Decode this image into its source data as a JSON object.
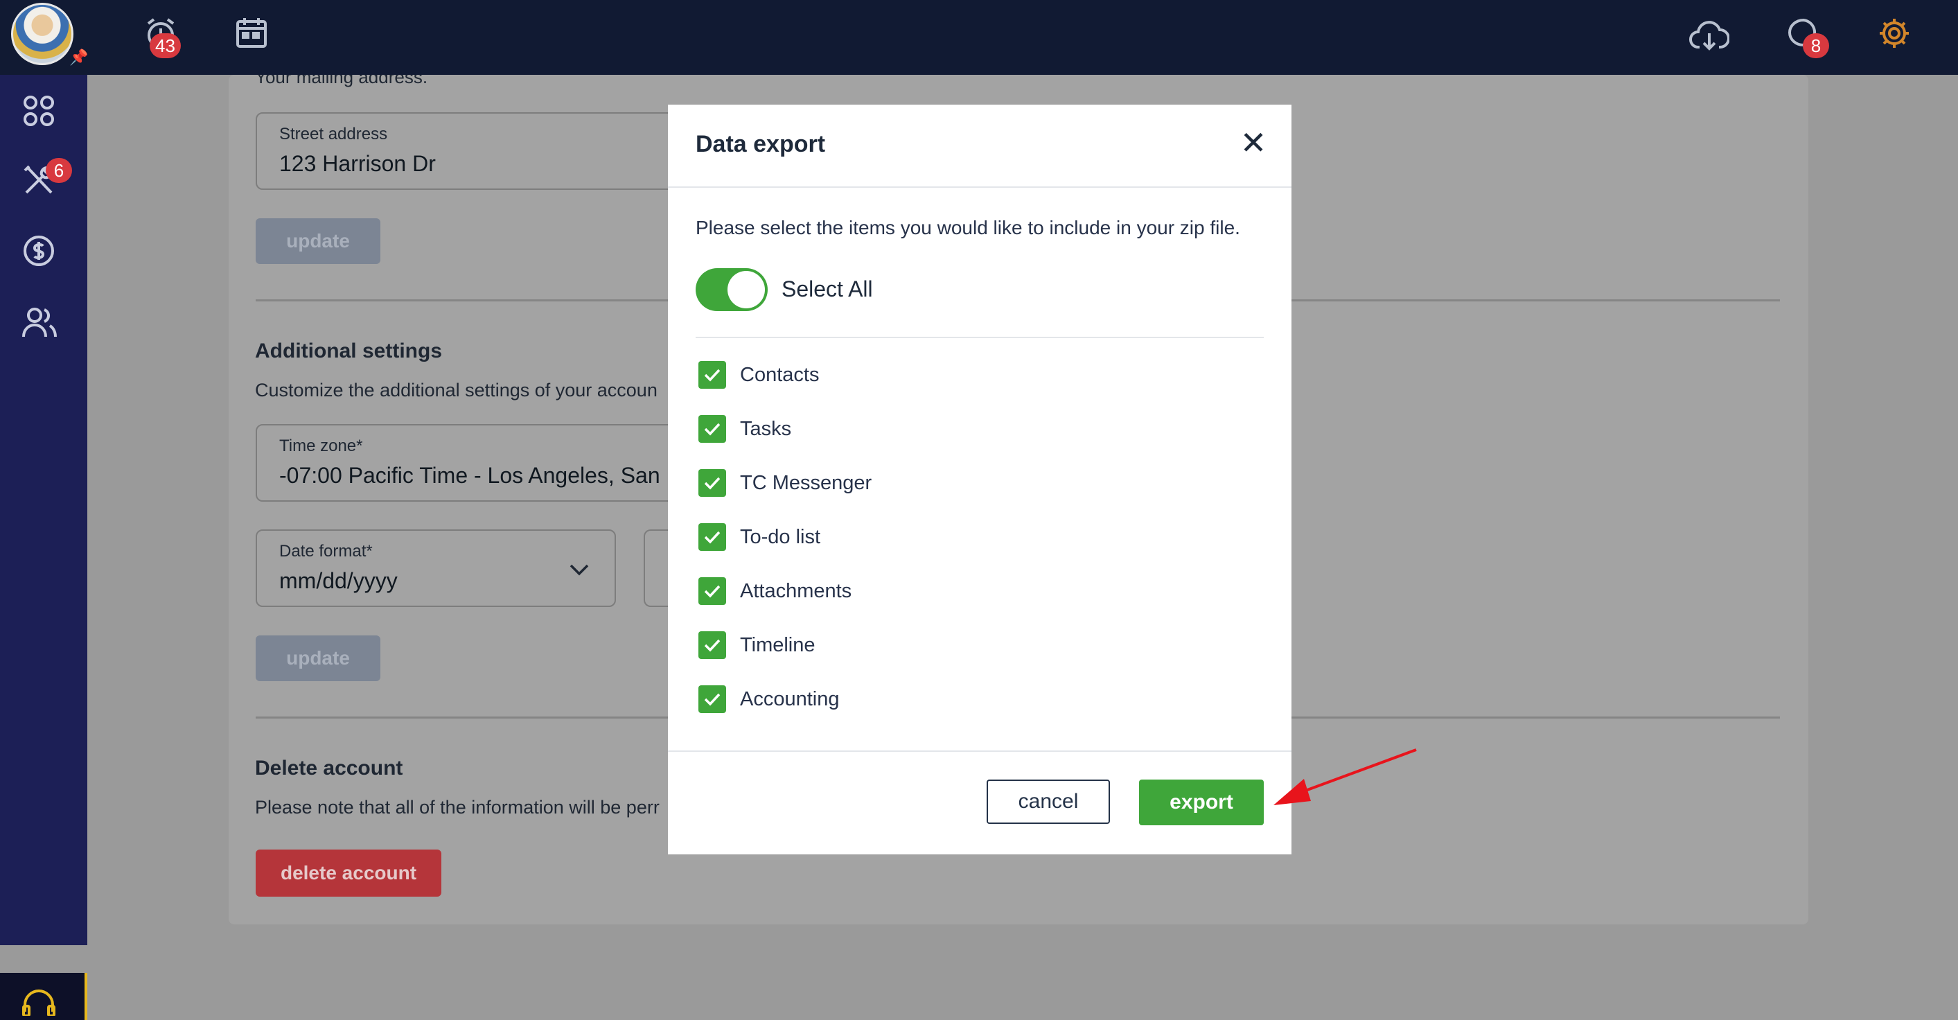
{
  "topbar": {
    "reminders_badge": "43",
    "messages_badge": "8"
  },
  "sidebar": {
    "tools_badge": "6"
  },
  "background": {
    "mailing_text": "Your mailing address.",
    "street": {
      "label": "Street address",
      "value": "123 Harrison Dr"
    },
    "update_label": "update",
    "additional_title": "Additional settings",
    "additional_desc": "Customize the additional settings of your accoun",
    "timezone": {
      "label": "Time zone*",
      "value": "-07:00 Pacific Time - Los Angeles, San D"
    },
    "dateformat": {
      "label": "Date format*",
      "value": "mm/dd/yyyy"
    },
    "delete_title": "Delete account",
    "delete_desc": "Please note that all of the information will be perr",
    "delete_button": "delete account"
  },
  "modal": {
    "title": "Data export",
    "close_symbol": "✕",
    "description": "Please select the items you would like to include in your zip file.",
    "select_all_label": "Select All",
    "select_all_on": true,
    "items": [
      {
        "label": "Contacts",
        "checked": true
      },
      {
        "label": "Tasks",
        "checked": true
      },
      {
        "label": "TC Messenger",
        "checked": true
      },
      {
        "label": "To-do list",
        "checked": true
      },
      {
        "label": "Attachments",
        "checked": true
      },
      {
        "label": "Timeline",
        "checked": true
      },
      {
        "label": "Accounting",
        "checked": true
      }
    ],
    "cancel_label": "cancel",
    "export_label": "export"
  },
  "colors": {
    "accent_green": "#3fa63a",
    "topbar": "#111a33",
    "sidebar": "#1c1f56",
    "danger": "#b5353a",
    "badge": "#d8393f",
    "annotation_arrow": "#e8141c"
  },
  "icons": [
    "avatar",
    "pin-icon",
    "alarm-clock-icon",
    "calendar-icon",
    "cloud-download-icon",
    "chat-icon",
    "gear-icon",
    "dashboard-icon",
    "tools-icon",
    "dollar-icon",
    "users-icon",
    "headset-icon",
    "chevron-down-icon",
    "close-icon",
    "check-icon",
    "arrow-annotation"
  ]
}
